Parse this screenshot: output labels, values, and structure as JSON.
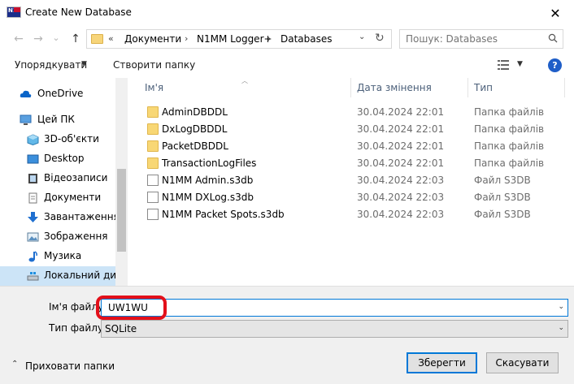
{
  "window": {
    "title": "Create New Database",
    "close_glyph": "✕",
    "app_icon_text": "N1"
  },
  "nav": {
    "back_glyph": "←",
    "forward_glyph": "→",
    "recent_glyph": "⌄",
    "up_glyph": "↑",
    "address": {
      "prefix": "«",
      "segments": [
        "Документи",
        "N1MM Logger+",
        "Databases"
      ],
      "separator": "›"
    },
    "search_placeholder": "Пошук: Databases"
  },
  "toolbar": {
    "organize": "Упорядкувати",
    "new_folder": "Створити папку",
    "help": "?"
  },
  "sidebar": {
    "items": [
      {
        "label": "OneDrive",
        "icon": "cloud-icon",
        "indent": 0
      },
      {
        "label": "Цей ПК",
        "icon": "computer-icon",
        "indent": 0
      },
      {
        "label": "3D-об'єкти",
        "icon": "cube-icon",
        "indent": 1
      },
      {
        "label": "Desktop",
        "icon": "desktop-icon",
        "indent": 1
      },
      {
        "label": "Відеозаписи",
        "icon": "video-icon",
        "indent": 1
      },
      {
        "label": "Документи",
        "icon": "document-icon",
        "indent": 1
      },
      {
        "label": "Завантаження",
        "icon": "download-icon",
        "indent": 1
      },
      {
        "label": "Зображення",
        "icon": "picture-icon",
        "indent": 1
      },
      {
        "label": "Музика",
        "icon": "music-icon",
        "indent": 1
      },
      {
        "label": "Локальний диск",
        "icon": "drive-icon",
        "indent": 1
      }
    ]
  },
  "files": {
    "columns": {
      "name": "Ім'я",
      "date": "Дата змінення",
      "type": "Тип"
    },
    "rows": [
      {
        "name": "AdminDBDDL",
        "date": "30.04.2024 22:01",
        "type": "Папка файлів",
        "kind": "folder"
      },
      {
        "name": "DxLogDBDDL",
        "date": "30.04.2024 22:01",
        "type": "Папка файлів",
        "kind": "folder"
      },
      {
        "name": "PacketDBDDL",
        "date": "30.04.2024 22:01",
        "type": "Папка файлів",
        "kind": "folder"
      },
      {
        "name": "TransactionLogFiles",
        "date": "30.04.2024 22:01",
        "type": "Папка файлів",
        "kind": "folder"
      },
      {
        "name": "N1MM Admin.s3db",
        "date": "30.04.2024 22:03",
        "type": "Файл S3DB",
        "kind": "file"
      },
      {
        "name": "N1MM DXLog.s3db",
        "date": "30.04.2024 22:03",
        "type": "Файл S3DB",
        "kind": "file"
      },
      {
        "name": "N1MM Packet Spots.s3db",
        "date": "30.04.2024 22:03",
        "type": "Файл S3DB",
        "kind": "file"
      }
    ]
  },
  "form": {
    "filename_label": "Ім'я файлу:",
    "filename_value": "UW1WU",
    "filetype_label": "Тип файлу:",
    "filetype_value": "SQLite",
    "hide_folders": "Приховати папки",
    "save": "Зберегти",
    "cancel": "Скасувати"
  },
  "colors": {
    "accent": "#0078d7",
    "highlight": "#e3101a",
    "selected": "#cce4f7",
    "help": "#1f5ec8"
  }
}
